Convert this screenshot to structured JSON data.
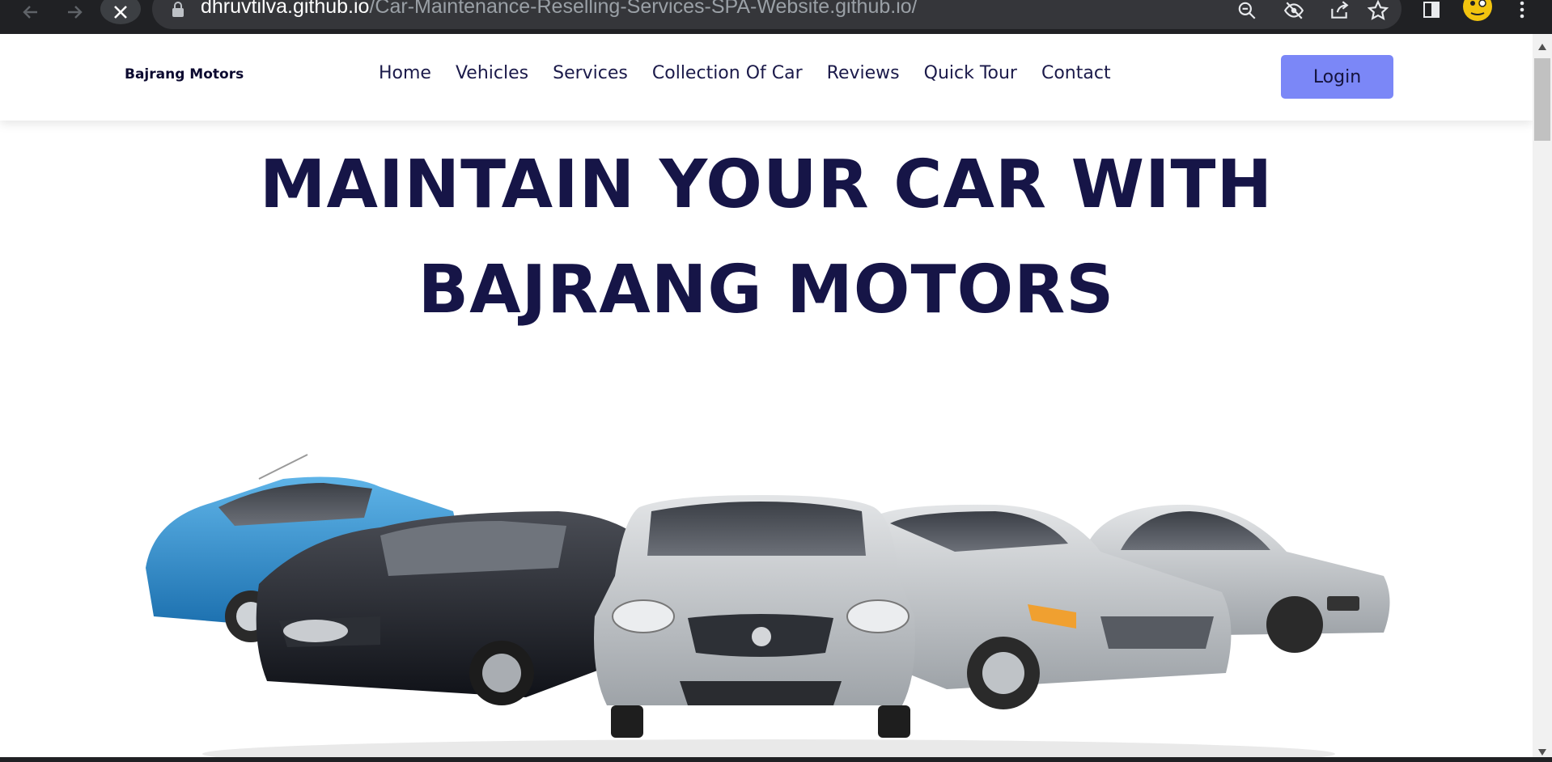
{
  "browser": {
    "url_host": "dhruvtilva.github.io",
    "url_path": "/Car-Maintenance-Reselling-Services-SPA-Website.github.io/"
  },
  "header": {
    "brand": "Bajrang Motors",
    "nav": [
      "Home",
      "Vehicles",
      "Services",
      "Collection Of Car",
      "Reviews",
      "Quick Tour",
      "Contact"
    ],
    "login_label": "Login"
  },
  "hero": {
    "title_line1": "MAINTAIN YOUR CAR WITH",
    "title_line2": "BAJRANG MOTORS"
  },
  "colors": {
    "nav_text": "#1b1a4a",
    "title": "#161547",
    "login_bg": "#7b87f7",
    "browser_bg": "#202124"
  },
  "icons": [
    "back-arrow-icon",
    "forward-arrow-icon",
    "stop-loading-icon",
    "lock-icon",
    "zoom-icon",
    "tracking-protection-icon",
    "share-icon",
    "bookmark-star-icon",
    "side-panel-icon",
    "profile-avatar-icon",
    "menu-kebab-icon"
  ]
}
